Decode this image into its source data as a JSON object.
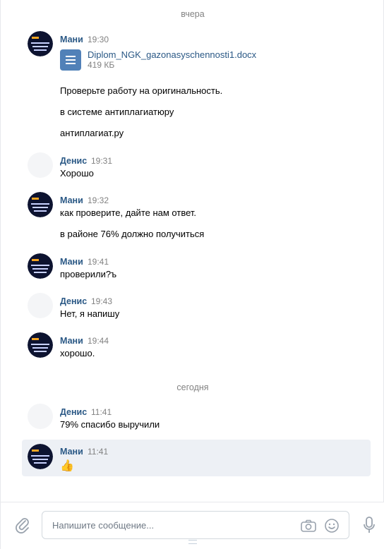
{
  "separators": {
    "yesterday": "вчера",
    "today": "сегодня"
  },
  "messages": [
    {
      "author": "Мани",
      "time": "19:30",
      "attachment": {
        "name": "Diplom_NGK_gazonasyschennosti1.docx",
        "size": "419 КБ",
        "icon": "document-icon"
      },
      "lines": [
        "Проверьте работу на оригинальность.",
        "в системе антиплагиатюру",
        "антиплагиат.ру"
      ]
    },
    {
      "author": "Денис",
      "time": "19:31",
      "lines": [
        "Хорошо"
      ]
    },
    {
      "author": "Мани",
      "time": "19:32",
      "lines": [
        "как проверите, дайте нам ответ.",
        "в районе 76% должно получиться"
      ]
    },
    {
      "author": "Мани",
      "time": "19:41",
      "lines": [
        "проверили?ъ"
      ]
    },
    {
      "author": "Денис",
      "time": "19:43",
      "lines": [
        "Нет, я напишу"
      ]
    },
    {
      "author": "Мани",
      "time": "19:44",
      "lines": [
        "хорошо."
      ]
    },
    {
      "author": "Денис",
      "time": "11:41",
      "lines": [
        "79% спасибо выручили"
      ]
    },
    {
      "author": "Мани",
      "time": "11:41",
      "emoji": "👍",
      "emoji_name": "thumbs-up-emoji"
    }
  ],
  "avatar_mani": {
    "lines": [
      "DIPLOMY",
      "KURSOVYE",
      "RABOTY"
    ],
    "bg": "#0d1330",
    "accent": "#f5a623"
  },
  "composer": {
    "placeholder": "Напишите сообщение...",
    "icons": [
      "paperclip-icon",
      "camera-icon",
      "emoji-icon",
      "microphone-icon"
    ]
  },
  "colors": {
    "author": "#2a5885",
    "time": "#828282",
    "highlight": "#edf0f5",
    "doc": "#5181b8"
  }
}
